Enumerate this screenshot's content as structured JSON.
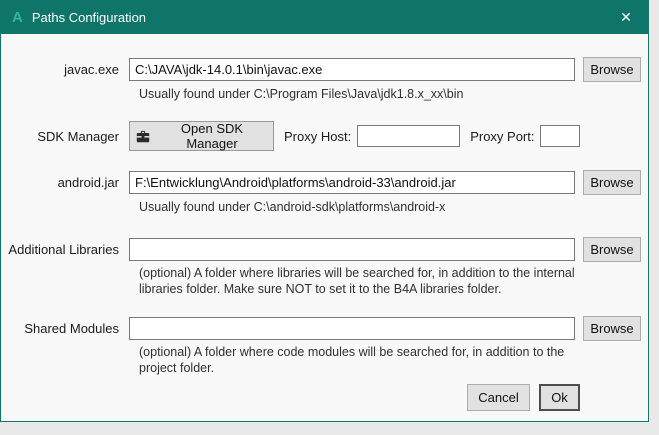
{
  "window": {
    "logo": "A",
    "title": "Paths Configuration",
    "close_icon": "✕",
    "titlebar_color": "#0e7568",
    "logo_color": "#2fb5a0"
  },
  "rows": {
    "javac": {
      "label": "javac.exe",
      "value": "C:\\JAVA\\jdk-14.0.1\\bin\\javac.exe",
      "hint": "Usually found under C:\\Program Files\\Java\\jdk1.8.x_xx\\bin",
      "browse_label": "Browse"
    },
    "sdk": {
      "label": "SDK Manager",
      "button_label": "Open SDK Manager",
      "button_icon": "toolbox-icon",
      "proxy_host_label": "Proxy Host:",
      "proxy_host_value": "",
      "proxy_port_label": "Proxy Port:",
      "proxy_port_value": ""
    },
    "android_jar": {
      "label": "android.jar",
      "value": "F:\\Entwicklung\\Android\\platforms\\android-33\\android.jar",
      "hint": "Usually found under C:\\android-sdk\\platforms\\android-x",
      "browse_label": "Browse"
    },
    "additional_libraries": {
      "label": "Additional Libraries",
      "value": "",
      "hint": "(optional) A folder where libraries will be searched for, in addition to the internal libraries folder. Make sure NOT to set it to the B4A libraries folder.",
      "browse_label": "Browse"
    },
    "shared_modules": {
      "label": "Shared Modules",
      "value": "",
      "hint": "(optional) A folder where code modules will be searched for, in addition to the project folder.",
      "browse_label": "Browse"
    }
  },
  "footer": {
    "cancel_label": "Cancel",
    "ok_label": "Ok"
  }
}
